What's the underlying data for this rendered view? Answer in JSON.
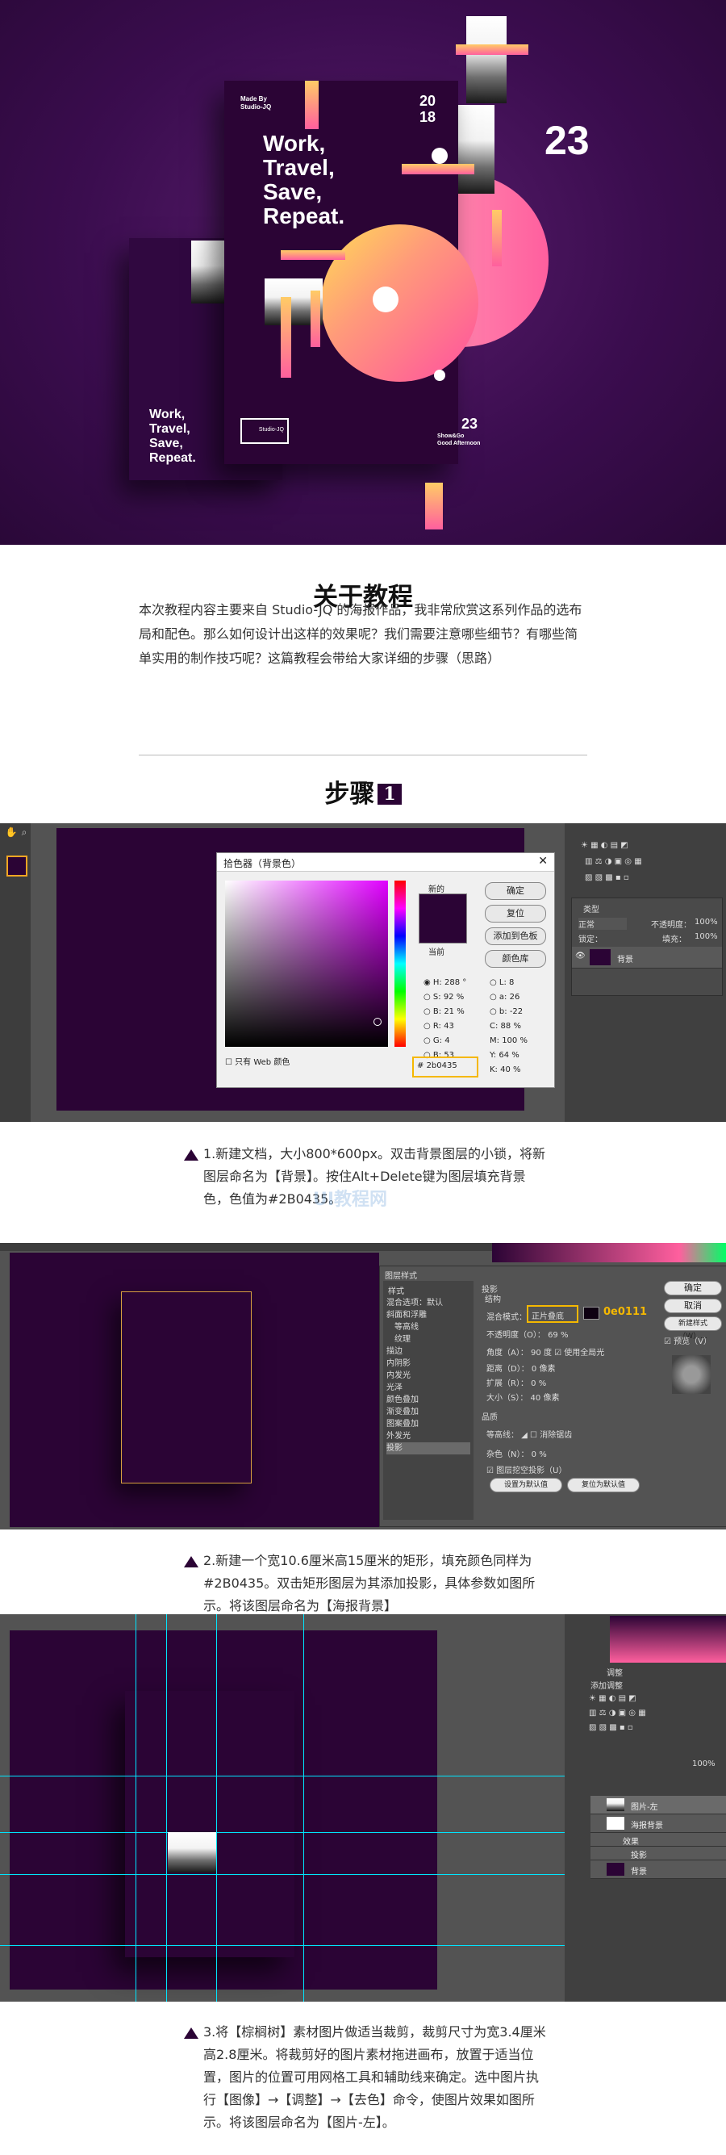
{
  "hero": {
    "made_by": "Made By\nStudio-JQ",
    "year": "20\n18",
    "title_lines": [
      "Work,",
      "Travel,",
      "Save,",
      "Repeat."
    ],
    "big_number": "23",
    "small_number": "23",
    "footer_text": "Show&Go\nGood Afternoon",
    "logo_text": "Studio-JQ",
    "back_title_lines": [
      "Work,",
      "Travel,",
      "Save,",
      "Repeat."
    ]
  },
  "intro": {
    "heading": "关于教程",
    "paragraph": "本次教程内容主要来自 Studio-JQ 的海报作品，我非常欣赏这系列作品的选布局和配色。那么如何设计出这样的效果呢？我们需要注意哪些细节？有哪些简单实用的制作技巧呢？这篇教程会带给大家详细的步骤（思路）"
  },
  "step": {
    "heading": "步骤",
    "number": "1"
  },
  "color_picker": {
    "title": "拾色器（背景色）",
    "new_label": "新的",
    "current_label": "当前",
    "ok": "确定",
    "reset": "复位",
    "add_swatch": "添加到色板",
    "color_lib": "颜色库",
    "web_only": "只有 Web 颜色",
    "hex": "2b0435",
    "hsb": {
      "H": "288",
      "S": "92",
      "B": "21"
    },
    "rgb": {
      "R": "43",
      "G": "4",
      "B": "53"
    },
    "lab": {
      "L": "8",
      "a": "26",
      "b": "-22"
    },
    "cmyk": {
      "C": "88",
      "M": "100",
      "Y": "64",
      "K": "40"
    },
    "layer_name": "背景",
    "kind_label": "类型",
    "mode_label": "正常",
    "opacity_label": "不透明度：",
    "opacity_value": "100%",
    "fill_label": "填充：",
    "lock_label": "锁定："
  },
  "caption1": "1.新建文档，大小800*600px。双击背景图层的小锁，将新图层命名为【背景】。按住Alt+Delete键为图层填充背景色，色值为#2B0435。",
  "watermark": "UI教程网",
  "layer_style": {
    "title": "图层样式",
    "styles_label": "样式",
    "list": [
      "混合选项：默认",
      "斜面和浮雕",
      "等高线",
      "纹理",
      "描边",
      "内阴影",
      "内发光",
      "光泽",
      "颜色叠加",
      "渐变叠加",
      "图案叠加",
      "外发光",
      "投影"
    ],
    "section_title": "投影",
    "structure": "结构",
    "blend_mode_label": "混合模式：",
    "blend_mode": "正片叠底",
    "hex": "0e0111",
    "opacity_label": "不透明度（O）：",
    "opacity": "69",
    "angle_label": "角度（A）：",
    "angle": "90",
    "global_light": "使用全局光",
    "distance_label": "距离（D）：",
    "distance": "0",
    "spread_label": "扩展（R）：",
    "spread": "0",
    "size_label": "大小（S）：",
    "size": "40",
    "quality": "品质",
    "contour_label": "等高线：",
    "anti_alias": "消除锯齿",
    "noise_label": "杂色（N）：",
    "noise": "0",
    "knockout": "图层挖空投影（U）",
    "default_btn": "设置为默认值",
    "reset_btn": "复位为默认值",
    "ok": "确定",
    "cancel": "取消",
    "new_style": "新建样式（W）...",
    "preview": "预览（V）"
  },
  "caption2": "2.新建一个宽10.6厘米高15厘米的矩形，填充颜色同样为#2B0435。双击矩形图层为其添加投影，具体参数如图所示。将该图层命名为【海报背景】",
  "layers3": {
    "adjust_tab": "调整",
    "add_adjust": "添加调整",
    "items": [
      {
        "name": "图片-左"
      },
      {
        "name": "海报背景"
      },
      {
        "name": "效果"
      },
      {
        "name": "投影"
      },
      {
        "name": "背景"
      }
    ],
    "opacity_value": "100%"
  },
  "caption3": "3.将【棕榈树】素材图片做适当裁剪，裁剪尺寸为宽3.4厘米高2.8厘米。将裁剪好的图片素材拖进画布，放置于适当位置，图片的位置可用网格工具和辅助线来确定。选中图片执行【图像】→【调整】→【去色】命令，使图片效果如图所示。将该图层命名为【图片-左】。"
}
